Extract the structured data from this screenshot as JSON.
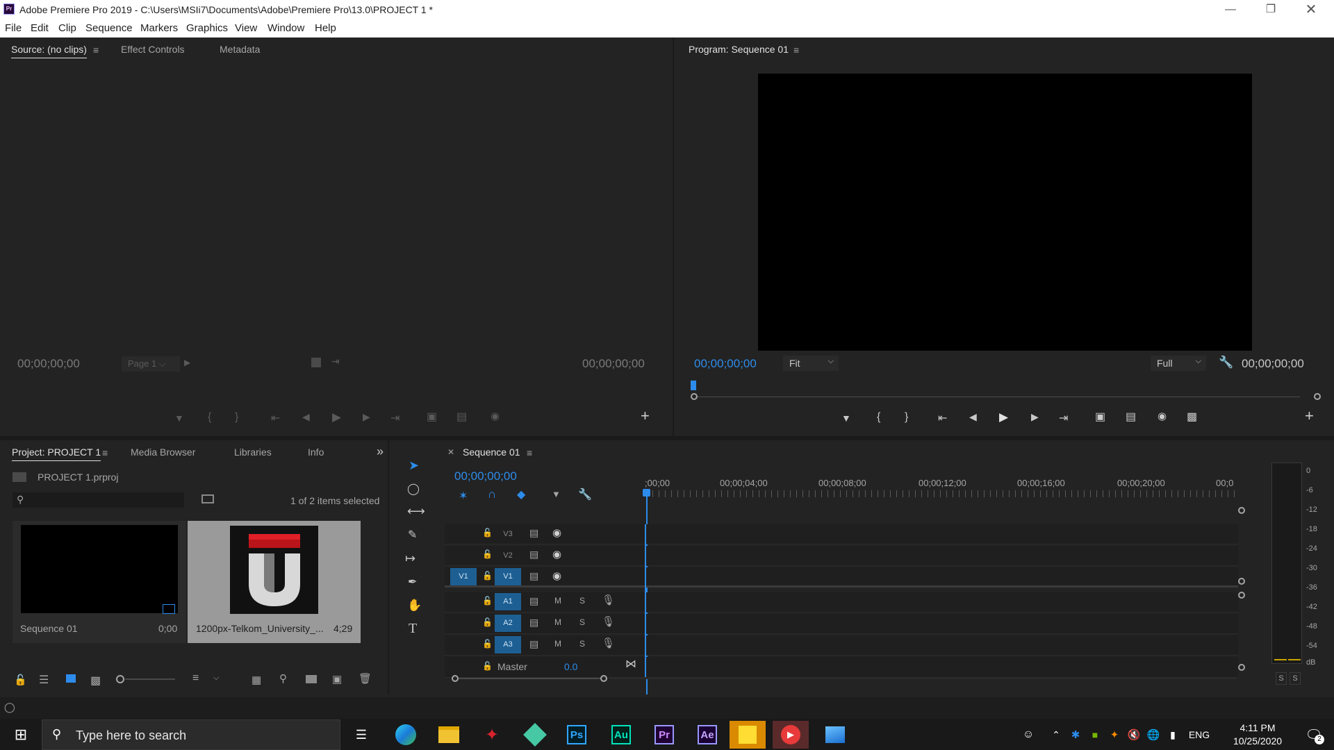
{
  "window": {
    "title": "Adobe Premiere Pro 2019 - C:\\Users\\MSIi7\\Documents\\Adobe\\Premiere Pro\\13.0\\PROJECT 1 *",
    "app_badge": "Pr"
  },
  "menu": [
    "File",
    "Edit",
    "Clip",
    "Sequence",
    "Markers",
    "Graphics",
    "View",
    "Window",
    "Help"
  ],
  "source_panel": {
    "tabs": [
      "Source: (no clips)",
      "Effect Controls",
      "Metadata"
    ],
    "timecode_left": "00;00;00;00",
    "timecode_right": "00;00;00;00",
    "page_select": "Page 1"
  },
  "program_panel": {
    "tab": "Program: Sequence 01",
    "timecode_left": "00;00;00;00",
    "timecode_right": "00;00;00;00",
    "zoom": "Fit",
    "quality": "Full"
  },
  "project_panel": {
    "tabs": [
      "Project: PROJECT 1",
      "Media Browser",
      "Libraries",
      "Info"
    ],
    "file": "PROJECT 1.prproj",
    "search_placeholder": "",
    "selection_status": "1 of 2 items selected",
    "items": [
      {
        "name": "Sequence 01",
        "duration": "0;00"
      },
      {
        "name": "1200px-Telkom_University_...",
        "duration": "4;29"
      }
    ]
  },
  "timeline": {
    "tab": "Sequence 01",
    "timecode": "00;00;00;00",
    "ruler": [
      ";00;00",
      "00;00;04;00",
      "00;00;08;00",
      "00;00;12;00",
      "00;00;16;00",
      "00;00;20;00",
      "00;0"
    ],
    "video_tracks": [
      "V3",
      "V2",
      "V1"
    ],
    "audio_tracks": [
      "A1",
      "A2",
      "A3"
    ],
    "source_patch_v": "V1",
    "master_label": "Master",
    "master_value": "0.0",
    "mute_label": "M",
    "solo_label": "S"
  },
  "audio_meter": {
    "scale": [
      "0",
      "-6",
      "-12",
      "-18",
      "-24",
      "-30",
      "-36",
      "-42",
      "-48",
      "-54",
      "dB"
    ],
    "solo_buttons": [
      "S",
      "S"
    ]
  },
  "taskbar": {
    "search_placeholder": "Type here to search",
    "apps": [
      "Ps",
      "Au",
      "Pr",
      "Ae"
    ],
    "language": "ENG",
    "time": "4:11 PM",
    "date": "10/25/2020",
    "notification_count": "2"
  }
}
